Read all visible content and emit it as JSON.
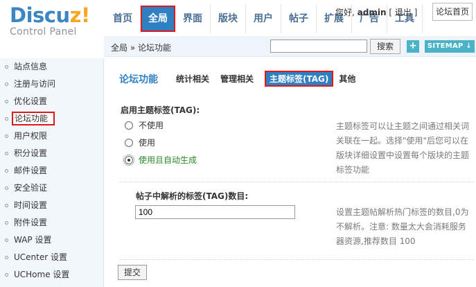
{
  "logo": {
    "brand_part1": "Discu",
    "brand_part2": "z!",
    "subtitle": "Control Panel"
  },
  "topnav": [
    {
      "label": "首页"
    },
    {
      "label": "全局",
      "active": true
    },
    {
      "label": "界面"
    },
    {
      "label": "版块"
    },
    {
      "label": "用户"
    },
    {
      "label": "帖子"
    },
    {
      "label": "扩展"
    },
    {
      "label": "广告"
    },
    {
      "label": "工具"
    }
  ],
  "user": {
    "greeting": "您好,",
    "name": "admin",
    "logout": "[ 退出 ]",
    "home": "论坛首页"
  },
  "subbar": {
    "breadcrumb": "全局 » 论坛功能",
    "search_value": "",
    "search_button": "搜索",
    "plus": "+",
    "sitemap": "SITEMAP ↓"
  },
  "sidebar": [
    {
      "label": "站点信息"
    },
    {
      "label": "注册与访问"
    },
    {
      "label": "优化设置"
    },
    {
      "label": "论坛功能",
      "active": true
    },
    {
      "label": "用户权限"
    },
    {
      "label": "积分设置"
    },
    {
      "label": "邮件设置"
    },
    {
      "label": "安全验证"
    },
    {
      "label": "时间设置"
    },
    {
      "label": "附件设置"
    },
    {
      "label": "WAP 设置"
    },
    {
      "label": "UCenter 设置"
    },
    {
      "label": "UCHome 设置"
    }
  ],
  "main": {
    "title": "论坛功能",
    "tabs": [
      {
        "label": "统计相关"
      },
      {
        "label": "管理相关"
      },
      {
        "label": "主题标签(TAG)",
        "active": true
      },
      {
        "label": "其他"
      }
    ],
    "section1": {
      "title": "启用主题标签(TAG):",
      "options": [
        {
          "label": "不使用",
          "checked": false
        },
        {
          "label": "使用",
          "checked": false
        },
        {
          "label": "使用且自动生成",
          "checked": true
        }
      ],
      "tip": "主题标签可以让主题之间通过相关词关联在一起。选择\"使用\"后您可以在版块详细设置中设置每个版块的主题标签功能"
    },
    "section2": {
      "title": "帖子中解析的标签(TAG)数目:",
      "value": "100",
      "tip": "设置主题帖解析热门标签的数目,0为不解析。注意: 数量太大会消耗服务器资源,推荐数目 100"
    },
    "submit": "提交"
  },
  "colors": {
    "accent": "#2f80c2",
    "highlight": "#e01818",
    "selected_option": "#2b8a2b"
  }
}
